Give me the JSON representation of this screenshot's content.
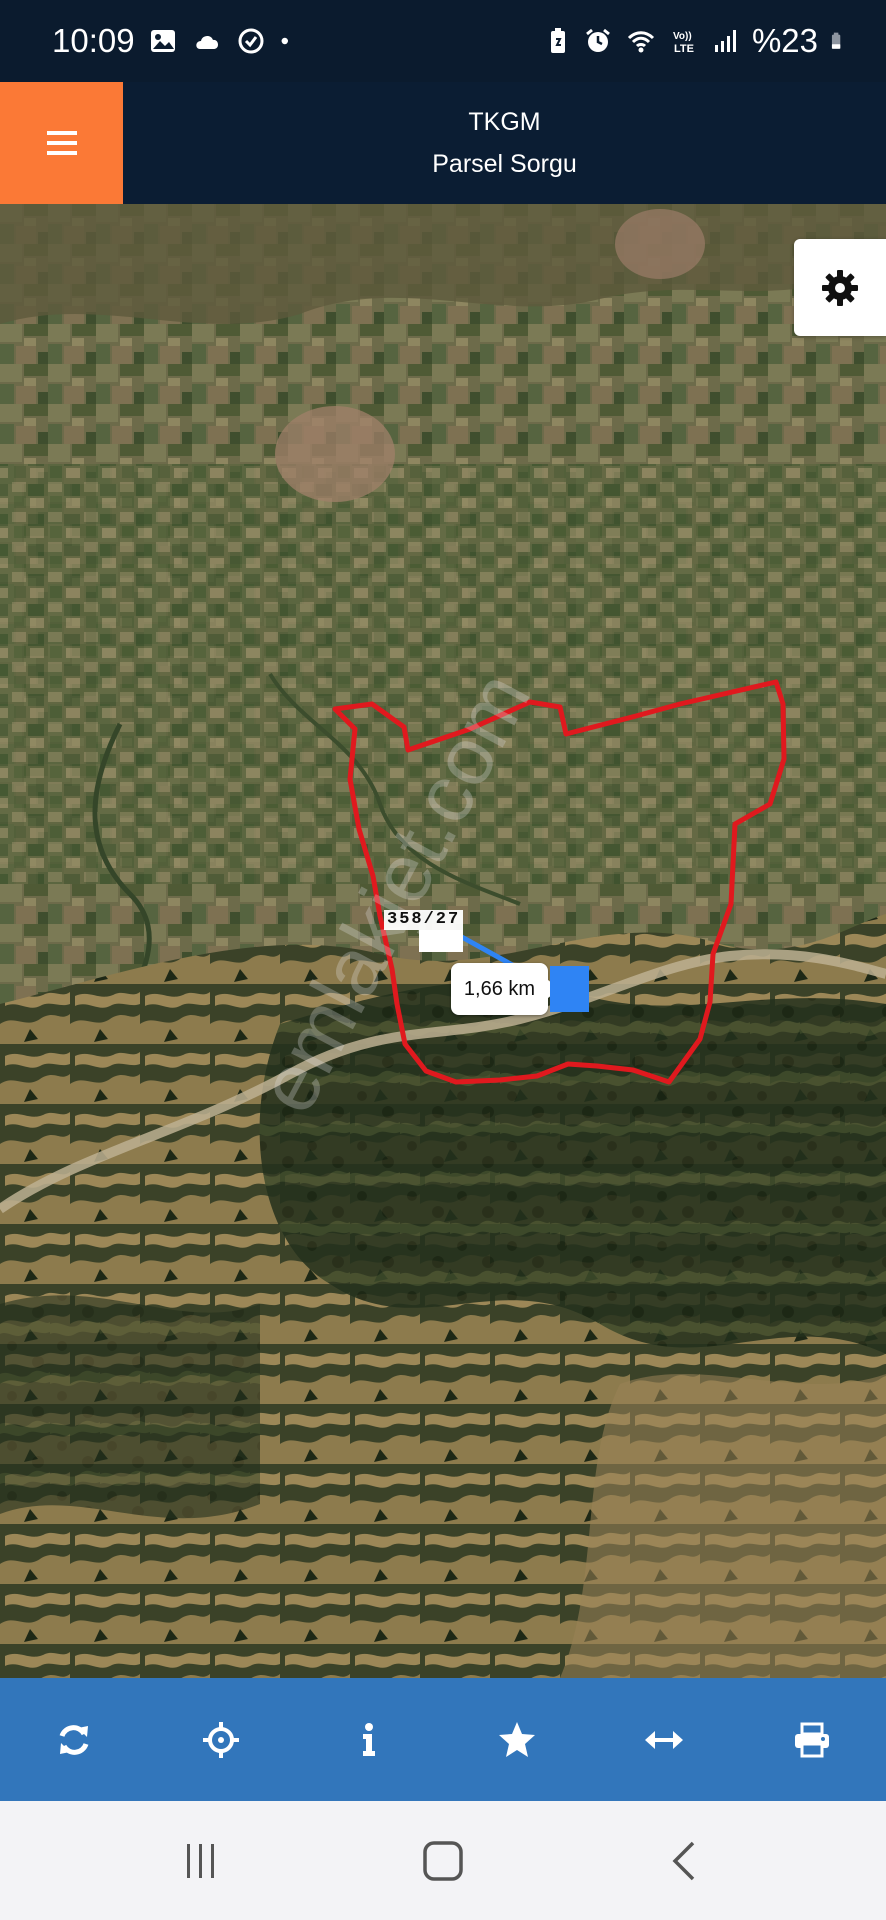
{
  "status_bar": {
    "time": "10:09",
    "battery": "%23",
    "left_icons": [
      "image-icon",
      "cloud-icon",
      "sync-icon",
      "dot-icon"
    ],
    "right_icons": [
      "battery-saver-icon",
      "alarm-icon",
      "wifi-icon",
      "volte-icon",
      "signal-icon",
      "battery-icon"
    ]
  },
  "header": {
    "title": "TKGM",
    "subtitle": "Parsel Sorgu",
    "menu_icon": "hamburger-menu-icon",
    "menu_color": "#fb7936",
    "background": "#0b1d33"
  },
  "map": {
    "parcel_label": "358/27",
    "distance_label": "1,66 km",
    "watermark": "emlakjet.com",
    "settings_icon": "gear-icon",
    "parcel_outline_color": "#e0191e",
    "marker_color": "#2f84f4"
  },
  "toolbar": {
    "background": "#3276bb",
    "buttons": [
      {
        "icon": "refresh-icon"
      },
      {
        "icon": "crosshair-locate-icon"
      },
      {
        "icon": "info-icon"
      },
      {
        "icon": "star-icon"
      },
      {
        "icon": "measure-arrows-icon"
      },
      {
        "icon": "print-icon"
      }
    ]
  },
  "nav_bar": {
    "buttons": [
      {
        "icon": "recents-icon"
      },
      {
        "icon": "home-icon"
      },
      {
        "icon": "back-icon"
      }
    ]
  }
}
